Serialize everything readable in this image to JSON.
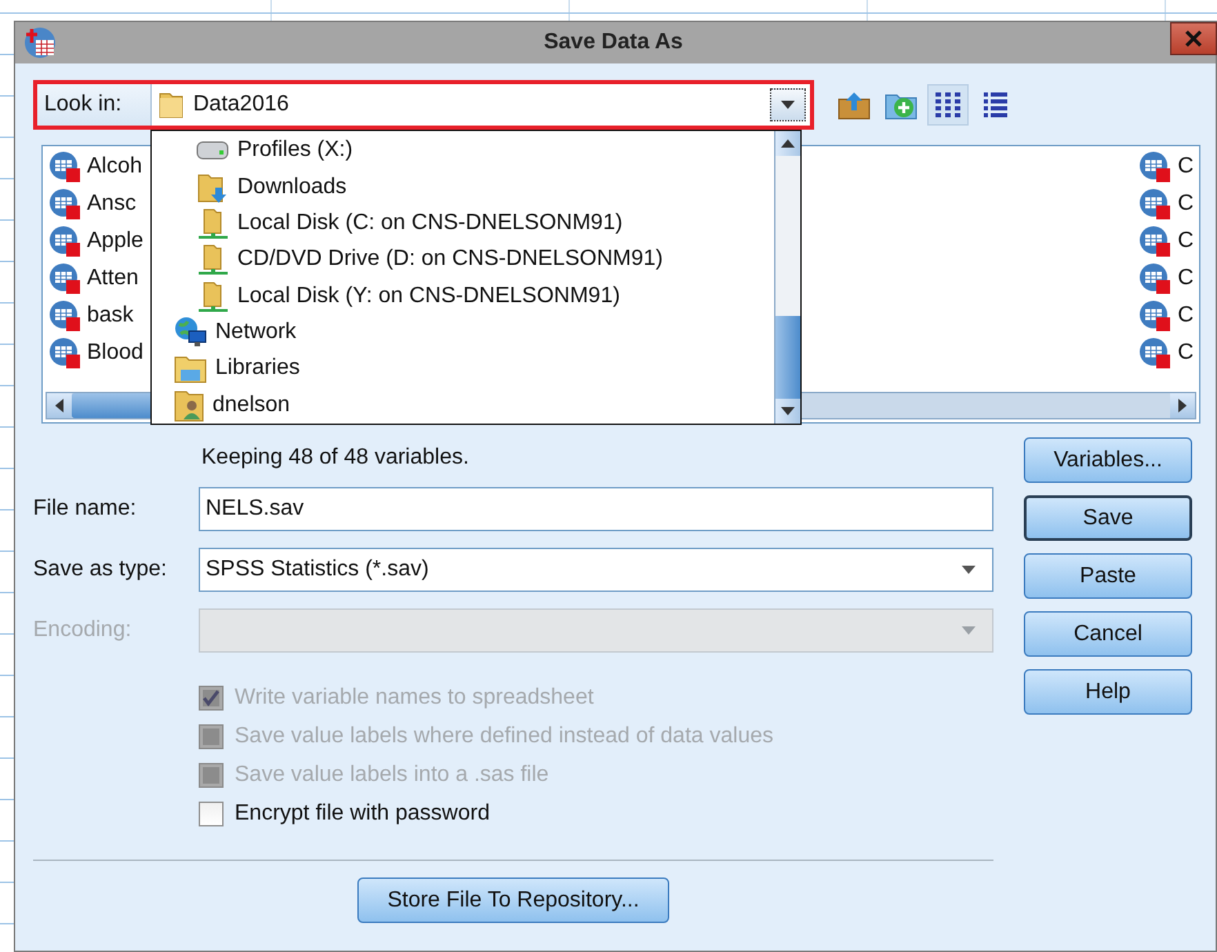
{
  "window": {
    "title": "Save Data As"
  },
  "look_in": {
    "label": "Look in:",
    "value": "Data2016",
    "expanded": true,
    "highlighted": true
  },
  "toolbar": [
    {
      "kind": "up-folder",
      "selected": false
    },
    {
      "kind": "new-folder",
      "selected": false
    },
    {
      "kind": "list-view",
      "selected": true
    },
    {
      "kind": "details-view",
      "selected": false
    }
  ],
  "files_left": [
    {
      "name": "Alcoh"
    },
    {
      "name": "Ansc"
    },
    {
      "name": "Apple"
    },
    {
      "name": "Atten"
    },
    {
      "name": "bask"
    },
    {
      "name": "Blood"
    }
  ],
  "files_right": [
    {
      "name": "C"
    },
    {
      "name": "C"
    },
    {
      "name": "C"
    },
    {
      "name": "C"
    },
    {
      "name": "C"
    },
    {
      "name": "C"
    }
  ],
  "dropdown": {
    "items": [
      {
        "label": "Profiles (X:)",
        "kind": "drive"
      },
      {
        "label": "Downloads",
        "kind": "downloads"
      },
      {
        "label": "Local Disk (C: on CNS-DNELSONM91)",
        "kind": "shared-drive"
      },
      {
        "label": "CD/DVD Drive (D: on CNS-DNELSONM91)",
        "kind": "shared-drive"
      },
      {
        "label": "Local Disk (Y: on CNS-DNELSONM91)",
        "kind": "shared-drive"
      },
      {
        "label": "Network",
        "kind": "network"
      },
      {
        "label": "Libraries",
        "kind": "libraries"
      },
      {
        "label": "dnelson",
        "kind": "user"
      }
    ]
  },
  "status": "Keeping 48 of 48 variables.",
  "fields": [
    {
      "label": "File name:",
      "kind": "text",
      "value": "NELS.sav",
      "disabled": false
    },
    {
      "label": "Save as type:",
      "kind": "combo",
      "value": "SPSS Statistics (*.sav)",
      "disabled": false
    },
    {
      "label": "Encoding:",
      "kind": "combo",
      "disabled": true
    }
  ],
  "options": [
    {
      "label": "Write variable names to spreadsheet",
      "checked": true,
      "disabled": true
    },
    {
      "label": "Save value labels where defined instead of data values",
      "checked": false,
      "disabled": true
    },
    {
      "label": "Save value labels into a .sas file",
      "checked": false,
      "disabled": true
    },
    {
      "label": "Encrypt file with password",
      "checked": false,
      "disabled": false
    }
  ],
  "buttons": [
    {
      "label": "Variables...",
      "default": false
    },
    {
      "label": "Save",
      "default": true
    },
    {
      "label": "Paste",
      "default": false
    },
    {
      "label": "Cancel",
      "default": false
    },
    {
      "label": "Help",
      "default": false
    }
  ],
  "repository_button": "Store File To Repository..."
}
